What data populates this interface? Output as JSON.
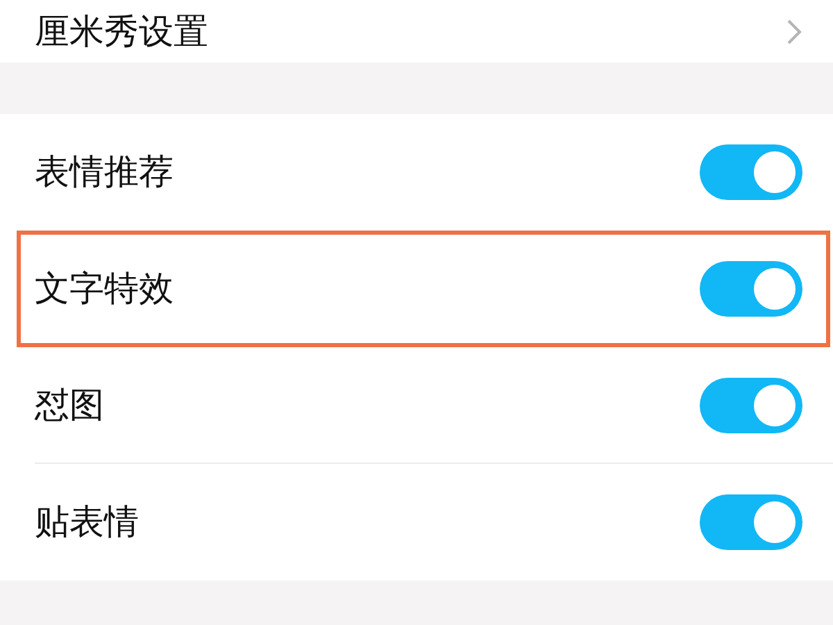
{
  "top_item": {
    "label": "厘米秀设置"
  },
  "items": [
    {
      "label": "表情推荐",
      "on": true,
      "highlighted": false
    },
    {
      "label": "文字特效",
      "on": true,
      "highlighted": true
    },
    {
      "label": "怼图",
      "on": true,
      "highlighted": false
    },
    {
      "label": "贴表情",
      "on": true,
      "highlighted": false
    }
  ]
}
